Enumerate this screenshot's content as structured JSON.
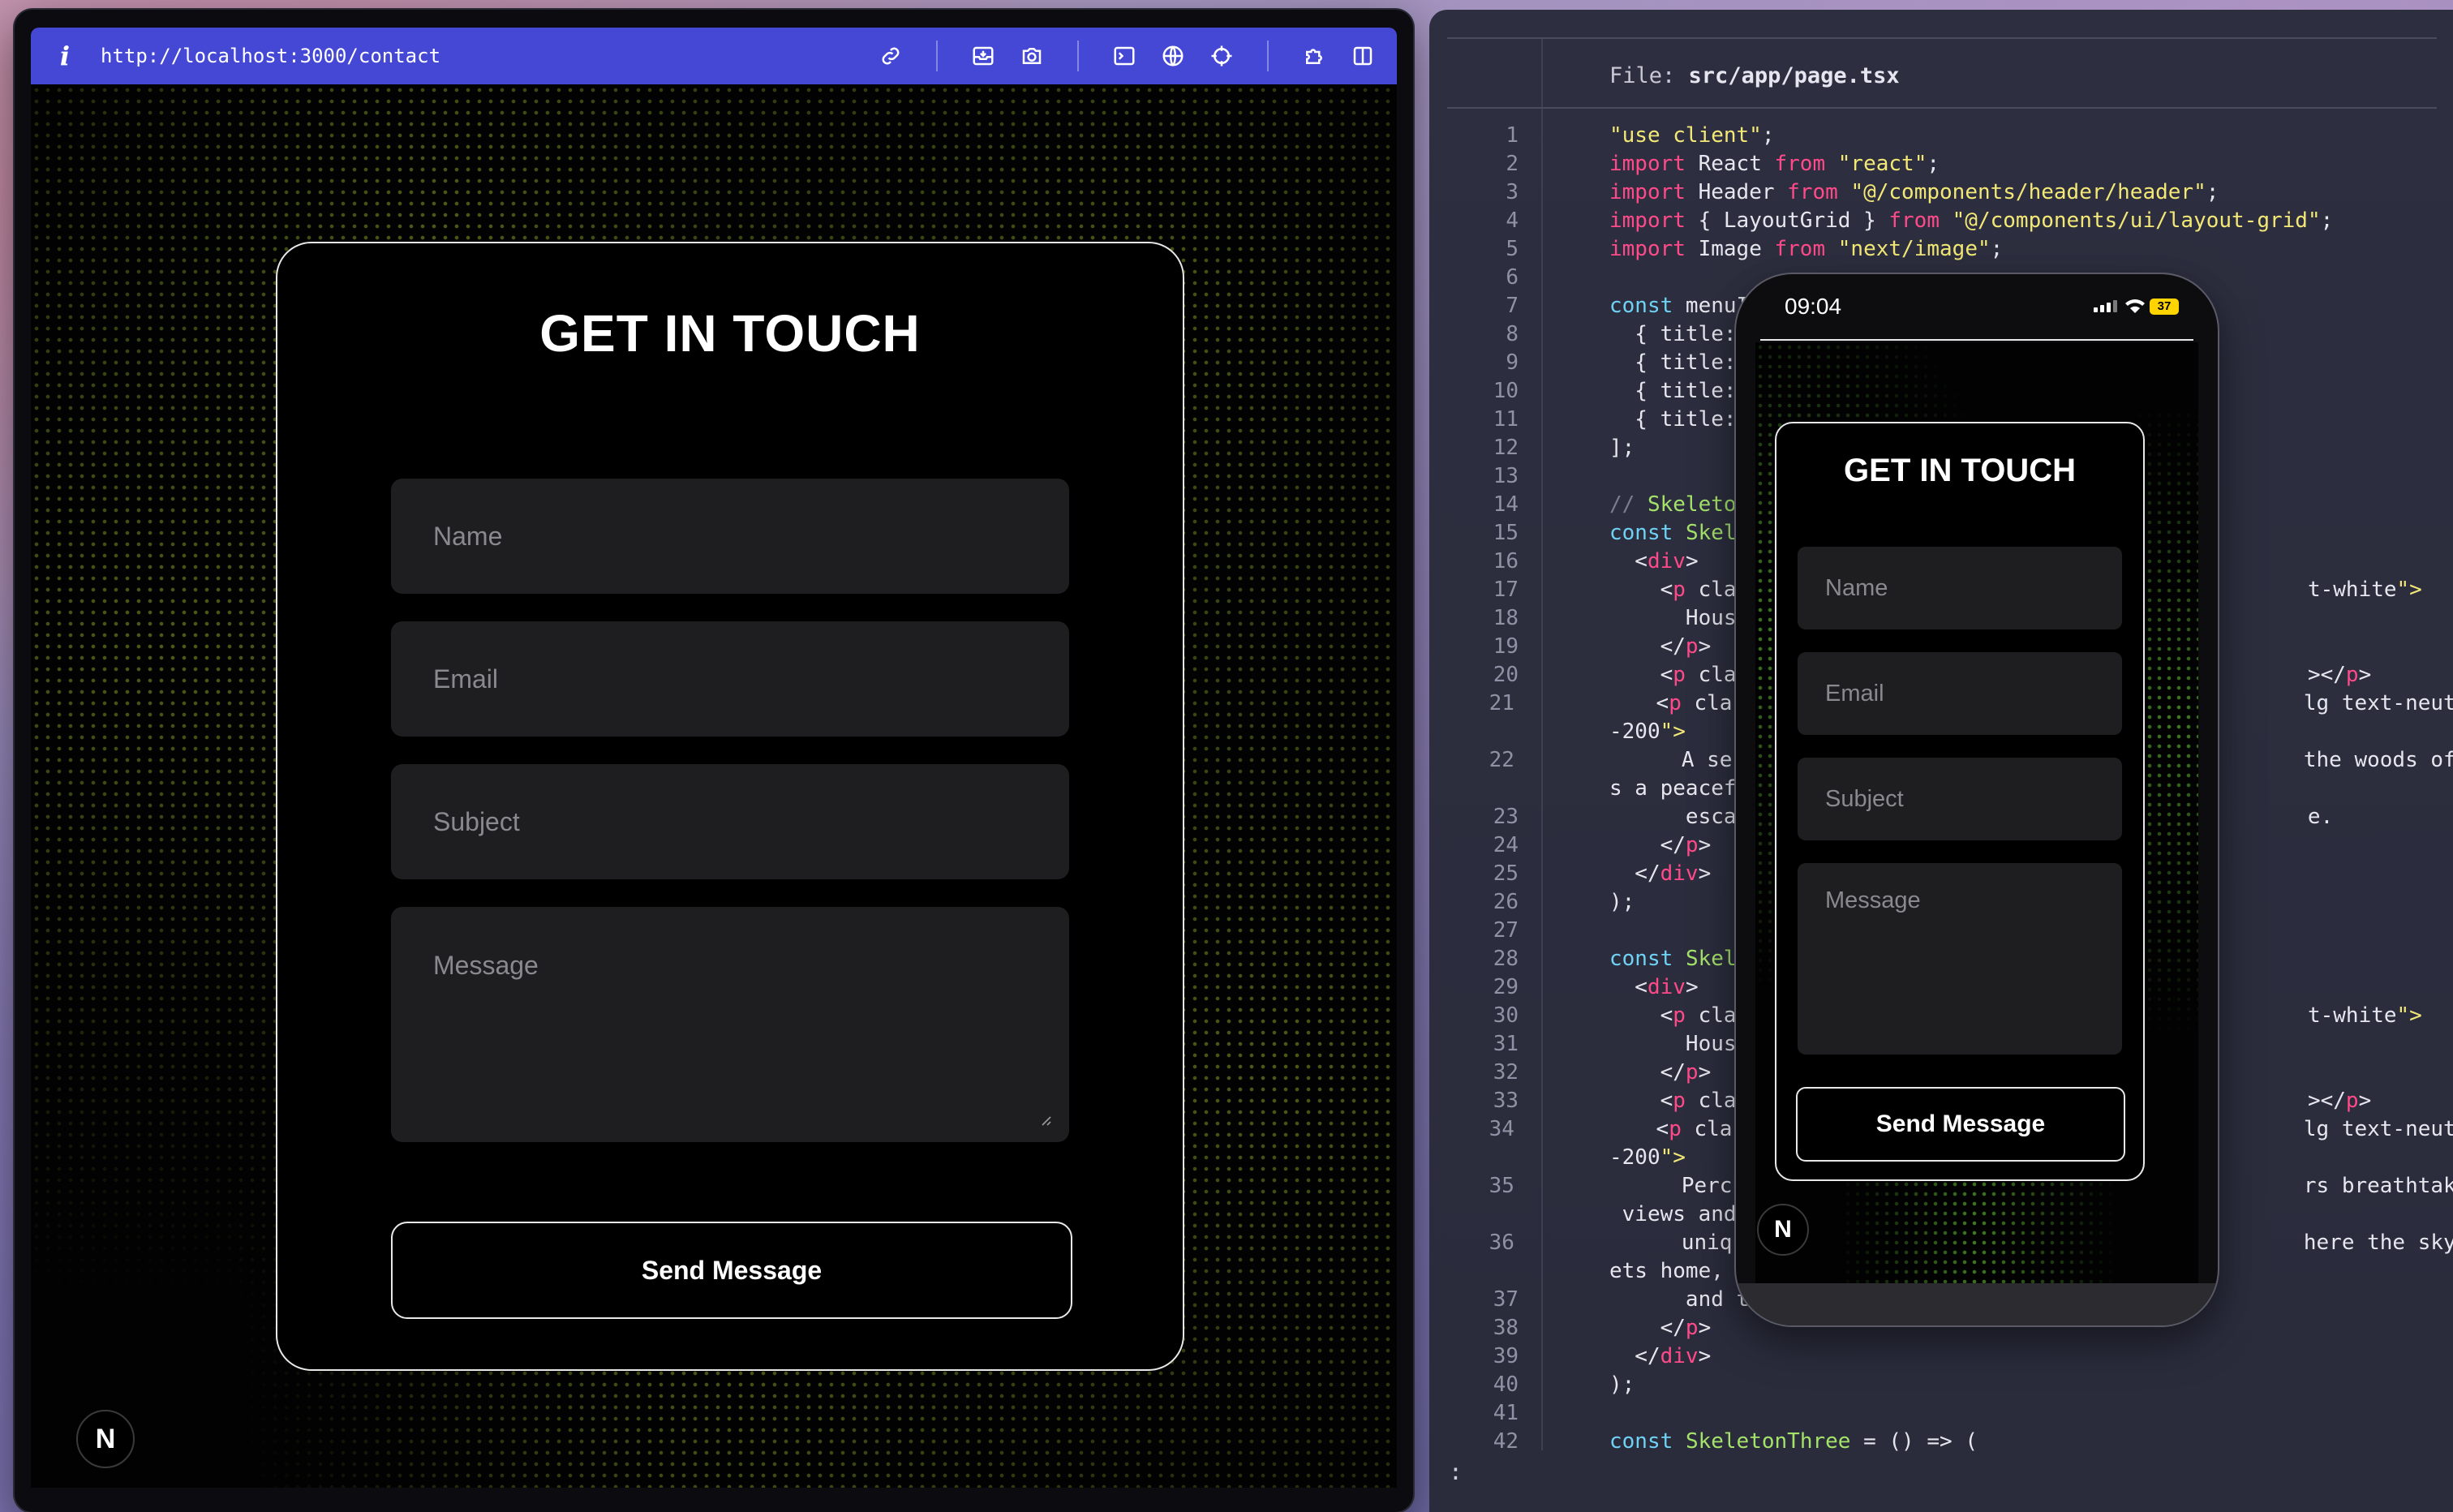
{
  "browser": {
    "info_glyph": "i",
    "url": "http://localhost:3000/contact",
    "toolbar_icons": [
      "link-icon",
      "inbox-icon",
      "camera-icon",
      "terminal-icon",
      "globe-icon",
      "crosshair-icon",
      "puzzle-icon",
      "split-view-icon"
    ]
  },
  "contact": {
    "heading": "GET IN TOUCH",
    "name_placeholder": "Name",
    "email_placeholder": "Email",
    "subject_placeholder": "Subject",
    "message_placeholder": "Message",
    "send_label": "Send Message"
  },
  "nextjs_badge": "N",
  "editor": {
    "file_label": "File:",
    "file_path": "src/app/page.tsx",
    "prompt": ":",
    "lines": [
      {
        "n": "1",
        "t": "\"use client\";"
      },
      {
        "n": "2",
        "t": "import React from \"react\";"
      },
      {
        "n": "3",
        "t": "import Header from \"@/components/header/header\";"
      },
      {
        "n": "4",
        "t": "import { LayoutGrid } from \"@/components/ui/layout-grid\";"
      },
      {
        "n": "5",
        "t": "import Image from \"next/image\";"
      },
      {
        "n": "6",
        "t": ""
      },
      {
        "n": "7",
        "t": "const menuItem"
      },
      {
        "n": "8",
        "t": "  { title: \"Ho"
      },
      {
        "n": "9",
        "t": "  { title: \"Ab"
      },
      {
        "n": "10",
        "t": "  { title: \"Se"
      },
      {
        "n": "11",
        "t": "  { title: \"Co"
      },
      {
        "n": "12",
        "t": "];"
      },
      {
        "n": "13",
        "t": ""
      },
      {
        "n": "14",
        "t": "// Skeleton c"
      },
      {
        "n": "15",
        "t": "const Skeleto"
      },
      {
        "n": "16",
        "t": "  <div>"
      },
      {
        "n": "17",
        "t": "    <p classN                                          t-white\">"
      },
      {
        "n": "18",
        "t": "      House i"
      },
      {
        "n": "19",
        "t": "    </p>"
      },
      {
        "n": "20",
        "t": "    <p classN                                          ></p>"
      },
      {
        "n": "21",
        "t": "    <p classN                                          lg text-neutral"
      },
      {
        "n": "",
        "t": "-200\">"
      },
      {
        "n": "22",
        "t": "      A seren                                          the woods offer"
      },
      {
        "n": "",
        "t": "s a peaceful"
      },
      {
        "n": "23",
        "t": "      escape                                           e."
      },
      {
        "n": "24",
        "t": "    </p>"
      },
      {
        "n": "25",
        "t": "  </div>"
      },
      {
        "n": "26",
        "t": ");"
      },
      {
        "n": "27",
        "t": ""
      },
      {
        "n": "28",
        "t": "const Skeleto"
      },
      {
        "n": "29",
        "t": "  <div>"
      },
      {
        "n": "30",
        "t": "    <p classN                                          t-white\">"
      },
      {
        "n": "31",
        "t": "      House a"
      },
      {
        "n": "32",
        "t": "    </p>"
      },
      {
        "n": "33",
        "t": "    <p classN                                          ></p>"
      },
      {
        "n": "34",
        "t": "    <p classN                                          lg text-neutral"
      },
      {
        "n": "",
        "t": "-200\">"
      },
      {
        "n": "35",
        "t": "      Perched                                          rs breathtaking"
      },
      {
        "n": "",
        "t": " views and a"
      },
      {
        "n": "36",
        "t": "      unique                                           here the sky me"
      },
      {
        "n": "",
        "t": "ets home,"
      },
      {
        "n": "37",
        "t": "      and tran"
      },
      {
        "n": "38",
        "t": "    </p>"
      },
      {
        "n": "39",
        "t": "  </div>"
      },
      {
        "n": "40",
        "t": ");"
      },
      {
        "n": "41",
        "t": ""
      },
      {
        "n": "42",
        "t": "const SkeletonThree = () => ("
      }
    ]
  },
  "phone": {
    "time": "09:04",
    "battery": "37",
    "heading": "GET IN TOUCH",
    "name_placeholder": "Name",
    "email_placeholder": "Email",
    "subject_placeholder": "Subject",
    "message_placeholder": "Message",
    "send_label": "Send Message"
  }
}
